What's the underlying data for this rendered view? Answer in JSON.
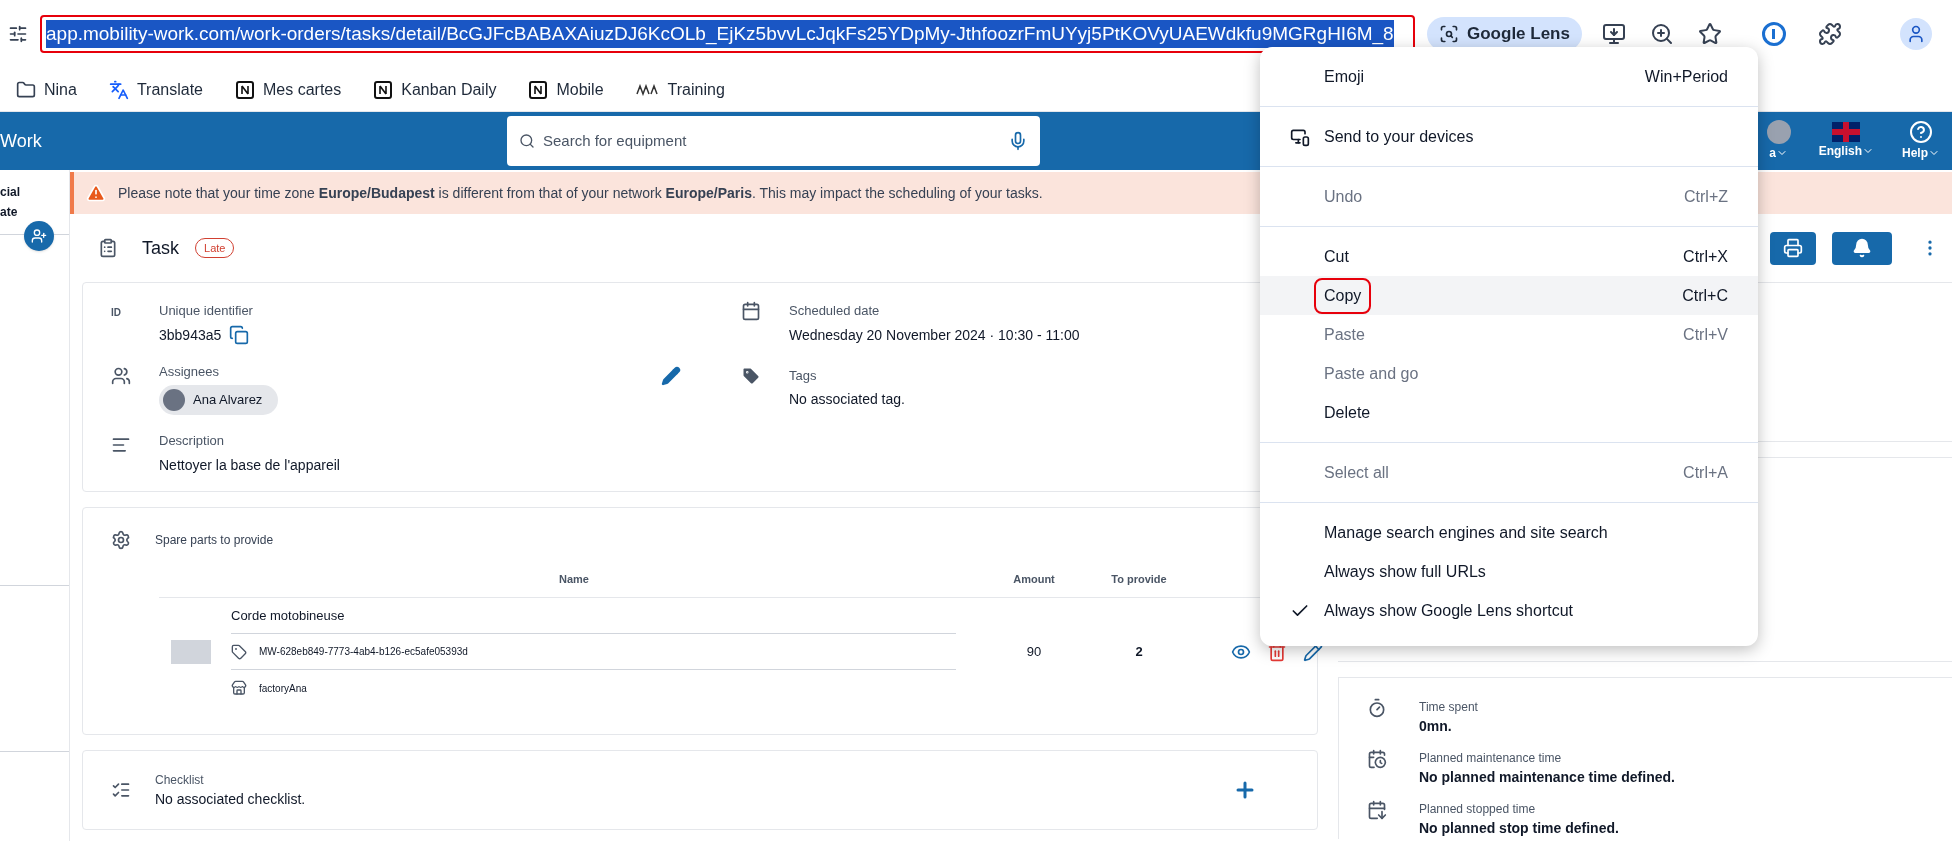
{
  "browser": {
    "url": "app.mobility-work.com/work-orders/tasks/detail/BcGJFcBABAXAiuzDJ6KcOLb_EjKz5bvvLcJqkFs25YDpMy-JthfoozrFmUYyj5PtKOVyUAEWdkfu9MGRgHI6M_8",
    "url_annotated": true,
    "lens_label": "Google Lens",
    "bookmarks": [
      {
        "label": "Nina",
        "kind": "folder"
      },
      {
        "label": "Translate",
        "kind": "translate"
      },
      {
        "label": "Mes cartes",
        "kind": "notion"
      },
      {
        "label": "Kanban Daily",
        "kind": "notion"
      },
      {
        "label": "Mobile",
        "kind": "notion"
      },
      {
        "label": "Training",
        "kind": "logo"
      }
    ]
  },
  "app_header": {
    "title_fragment": "Work",
    "search_placeholder": "Search for equipment",
    "user_fragment": "a",
    "language": "English",
    "help": "Help"
  },
  "sidebar": {
    "fragments": [
      "cial",
      "ate"
    ]
  },
  "banner": {
    "text": "Please note that your time zone **Europe/Budapest** is different from that of your network **Europe/Paris**. This may impact the scheduling of your tasks."
  },
  "task": {
    "title": "Task",
    "badge": "Late"
  },
  "details": {
    "identifier": {
      "glyph": "ID",
      "label": "Unique identifier",
      "value": "3bb943a5"
    },
    "assignees": {
      "label": "Assignees",
      "people": [
        "Ana Alvarez"
      ]
    },
    "description": {
      "label": "Description",
      "value": "Nettoyer la base de l'appareil"
    },
    "scheduled": {
      "label": "Scheduled date",
      "value": "Wednesday 20 November 2024 · 10:30 - 11:00"
    },
    "tags": {
      "label": "Tags",
      "value": "No associated tag."
    }
  },
  "spare_parts": {
    "title": "Spare parts to provide",
    "columns": [
      "Name",
      "Amount",
      "To provide"
    ],
    "rows": [
      {
        "name": "Corde motobineuse",
        "reference": "MW-628eb849-7773-4ab4-b126-ec5afe05393d",
        "location": "factoryAna",
        "amount": "90",
        "to_provide": "2"
      }
    ]
  },
  "checklist": {
    "label": "Checklist",
    "value": "No associated checklist."
  },
  "stats": [
    {
      "label": "Time spent",
      "value": "0mn.",
      "kind": "timer"
    },
    {
      "label": "Planned maintenance time",
      "value": "No planned maintenance time defined.",
      "kind": "calendar-clock"
    },
    {
      "label": "Planned stopped time",
      "value": "No planned stop time defined.",
      "kind": "calendar-arrow"
    }
  ],
  "context_menu": {
    "groups": [
      [
        {
          "label": "Emoji",
          "shortcut": "Win+Period",
          "kind": "plain",
          "disabled": false,
          "selected": false,
          "checked": false,
          "annotated": false
        }
      ],
      [
        {
          "label": "Send to your devices",
          "kind": "devices",
          "disabled": false,
          "selected": false,
          "checked": false,
          "annotated": false
        }
      ],
      [
        {
          "label": "Undo",
          "shortcut": "Ctrl+Z",
          "kind": "plain",
          "disabled": true,
          "selected": false,
          "checked": false,
          "annotated": false
        }
      ],
      [
        {
          "label": "Cut",
          "shortcut": "Ctrl+X",
          "kind": "plain",
          "disabled": false,
          "selected": false,
          "checked": false,
          "annotated": false
        },
        {
          "label": "Copy",
          "shortcut": "Ctrl+C",
          "kind": "plain",
          "disabled": false,
          "selected": true,
          "checked": false,
          "annotated": true
        },
        {
          "label": "Paste",
          "shortcut": "Ctrl+V",
          "kind": "plain",
          "disabled": true,
          "selected": false,
          "checked": false,
          "annotated": false
        },
        {
          "label": "Paste and go",
          "kind": "plain",
          "disabled": true,
          "selected": false,
          "checked": false,
          "annotated": false
        },
        {
          "label": "Delete",
          "kind": "plain",
          "disabled": false,
          "selected": false,
          "checked": false,
          "annotated": false
        }
      ],
      [
        {
          "label": "Select all",
          "shortcut": "Ctrl+A",
          "kind": "plain",
          "disabled": true,
          "selected": false,
          "checked": false,
          "annotated": false
        }
      ],
      [
        {
          "label": "Manage search engines and site search",
          "kind": "plain",
          "disabled": false,
          "selected": false,
          "checked": false,
          "annotated": false
        },
        {
          "label": "Always show full URLs",
          "kind": "plain",
          "disabled": false,
          "selected": false,
          "checked": false,
          "annotated": false
        },
        {
          "label": "Always show Google Lens shortcut",
          "kind": "plain",
          "disabled": false,
          "selected": false,
          "checked": true,
          "annotated": false
        }
      ]
    ]
  }
}
